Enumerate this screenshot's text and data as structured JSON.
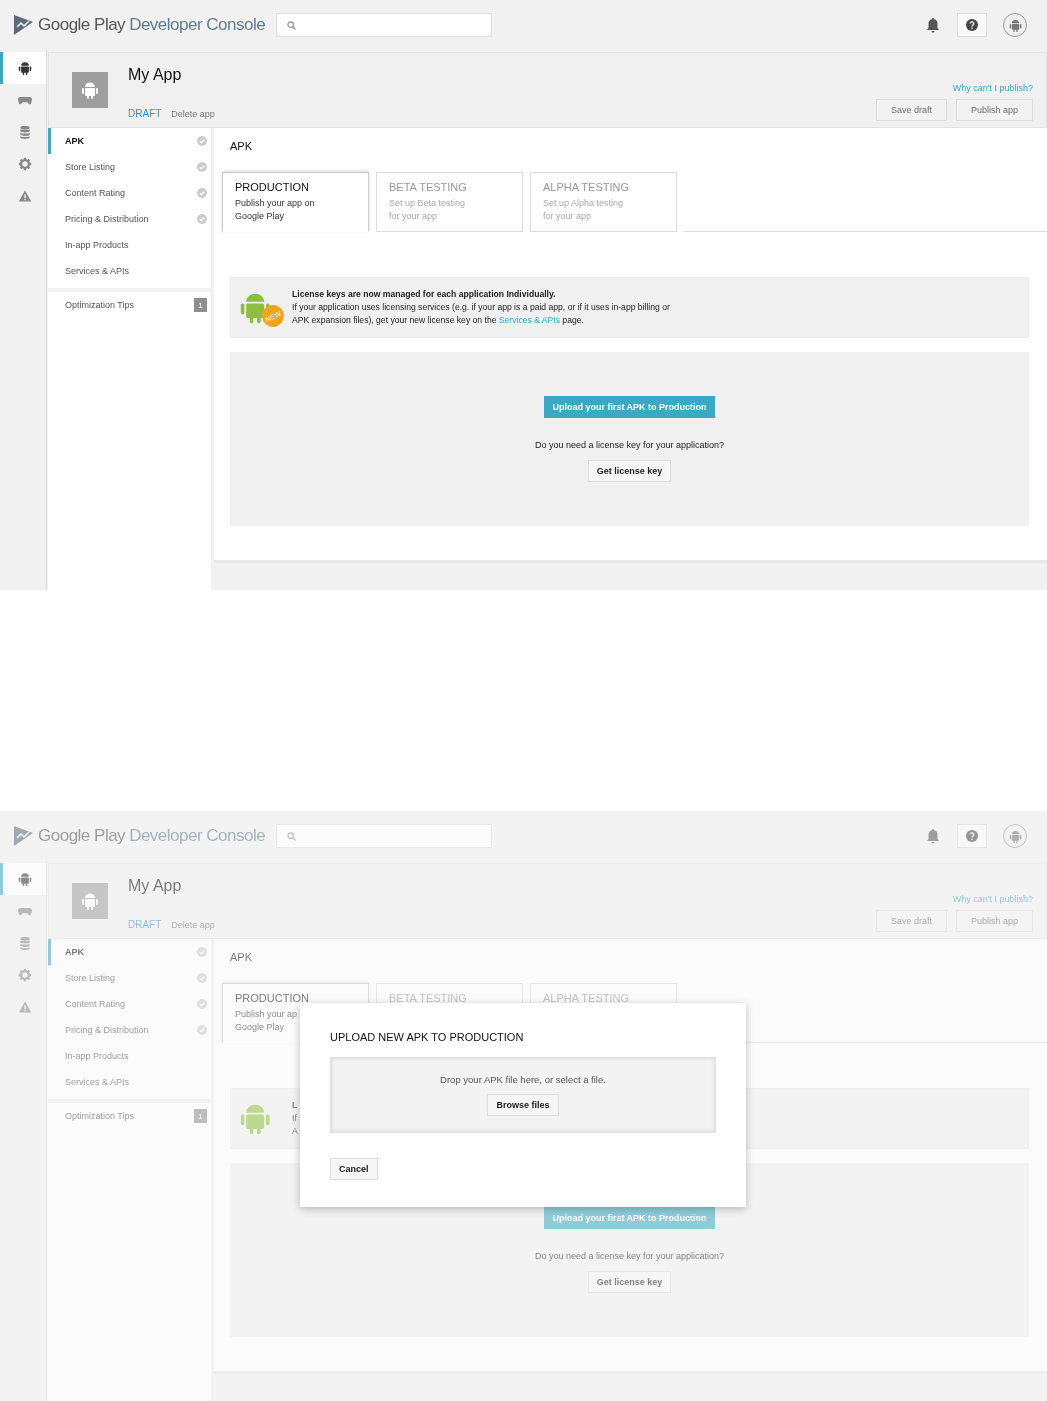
{
  "screens": [
    {
      "dimmed": false,
      "header": {
        "brand": "Google Play",
        "product": "Developer Console"
      },
      "rail": [
        {
          "kind": "android",
          "selected": true
        },
        {
          "kind": "gamepad",
          "selected": false
        },
        {
          "kind": "database",
          "selected": false
        },
        {
          "kind": "gear",
          "selected": false
        },
        {
          "kind": "warning",
          "selected": false
        }
      ],
      "app": {
        "title": "My App",
        "status": "DRAFT",
        "delete": "Delete app",
        "why": "Why can't I publish?",
        "buttons": [
          {
            "label": "Save draft",
            "disabled": true
          },
          {
            "label": "Publish app",
            "disabled": true
          }
        ]
      },
      "menu": [
        [
          {
            "label": "APK",
            "selected": true,
            "done": true
          },
          {
            "label": "Store Listing",
            "selected": false,
            "done": true
          },
          {
            "label": "Content Rating",
            "selected": false,
            "done": true
          },
          {
            "label": "Pricing & Distribution",
            "selected": false,
            "done": true
          },
          {
            "label": "In-app Products",
            "selected": false,
            "done": false
          },
          {
            "label": "Services & APIs",
            "selected": false,
            "done": false
          }
        ],
        [
          {
            "label": "Optimization Tips",
            "selected": false,
            "done": false,
            "badge": "1"
          }
        ]
      ],
      "section": "APK",
      "tabs": [
        {
          "title": "PRODUCTION",
          "description": "Publish your app on\nGoogle Play",
          "selected": true
        },
        {
          "title": "BETA TESTING",
          "description": "Set up Beta testing\nfor your app",
          "selected": false
        },
        {
          "title": "ALPHA TESTING",
          "description": "Set up Alpha testing\nfor your app",
          "selected": false
        }
      ],
      "notice": {
        "badge": "NEW",
        "title": "License keys are now managed for each application Individually.",
        "body": "If your application uses licensing services (e.g. if your app is a paid app, or if it uses in-app billing or\nAPK expansion files), get your new license key on the ",
        "link": "Services & APIs",
        "after": " page."
      },
      "upload": {
        "button": "Upload your first APK to Production",
        "question": "Do you need a license key for your application?",
        "license_button": "Get license key"
      }
    },
    {
      "dimmed": true,
      "header": {
        "brand": "Google Play",
        "product": "Developer Console"
      },
      "rail": [
        {
          "kind": "android",
          "selected": true
        },
        {
          "kind": "gamepad",
          "selected": false
        },
        {
          "kind": "database",
          "selected": false
        },
        {
          "kind": "gear",
          "selected": false
        },
        {
          "kind": "warning",
          "selected": false
        }
      ],
      "app": {
        "title": "My App",
        "status": "DRAFT",
        "delete": "Delete app",
        "why": "Why can't I publish?",
        "buttons": [
          {
            "label": "Save draft",
            "disabled": true
          },
          {
            "label": "Publish app",
            "disabled": true
          }
        ]
      },
      "menu": [
        [
          {
            "label": "APK",
            "selected": true,
            "done": true
          },
          {
            "label": "Store Listing",
            "selected": false,
            "done": true
          },
          {
            "label": "Content Rating",
            "selected": false,
            "done": true
          },
          {
            "label": "Pricing & Distribution",
            "selected": false,
            "done": true
          },
          {
            "label": "In-app Products",
            "selected": false,
            "done": false
          },
          {
            "label": "Services & APIs",
            "selected": false,
            "done": false
          }
        ],
        [
          {
            "label": "Optimization Tips",
            "selected": false,
            "done": false,
            "badge": "1"
          }
        ]
      ],
      "section": "APK",
      "tabs": [
        {
          "title": "PRODUCTION",
          "description": "Publish your ap\nGoogle Play",
          "selected": true
        },
        {
          "title": "BETA TESTING",
          "selected": false
        },
        {
          "title": "ALPHA TESTING",
          "selected": false
        }
      ],
      "notice": {
        "title": "L",
        "body": "If\nA"
      },
      "upload": {
        "button": "Upload your first APK to Production",
        "question": "Do you need a license key for your application?",
        "license_button": "Get license key"
      },
      "dialog": {
        "title": "UPLOAD NEW APK TO PRODUCTION",
        "drop_text": "Drop your APK file here, or select a file.",
        "browse": "Browse files",
        "cancel": "Cancel"
      }
    }
  ]
}
